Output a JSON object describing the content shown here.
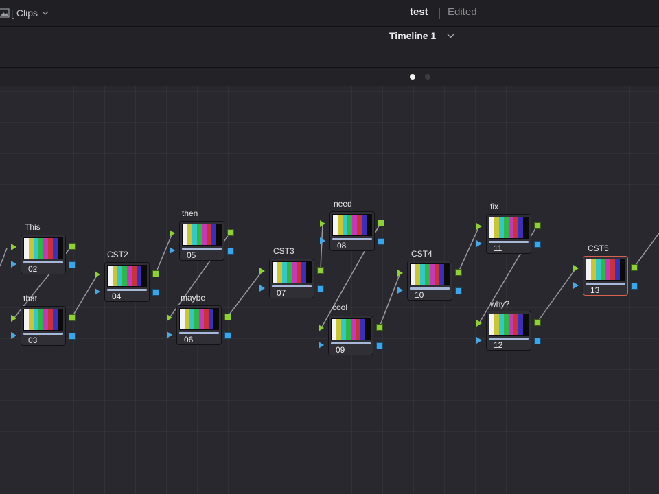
{
  "topbar": {
    "clips_label": "Clips",
    "bracket": "[",
    "project_name": "test",
    "project_status": "Edited"
  },
  "timeline": {
    "name": "Timeline 1"
  },
  "pager": {
    "pages": 2,
    "active_page": 1
  },
  "colors": {
    "rgb_port": "#8fcf3a",
    "key_port": "#4aa7e4",
    "selected_border": "#d8624f",
    "connection": "#9a9aa2"
  },
  "color_bars": [
    "#f4f4f4",
    "#c9c43a",
    "#35c7c0",
    "#2fb64f",
    "#c43ab2",
    "#c7323f",
    "#3c2fb4",
    "#0a0a0a"
  ],
  "nodes": [
    {
      "id": "02",
      "number": "02",
      "label": "This"
    },
    {
      "id": "03",
      "number": "03",
      "label": "that"
    },
    {
      "id": "04",
      "number": "04",
      "label": "CST2"
    },
    {
      "id": "05",
      "number": "05",
      "label": "then"
    },
    {
      "id": "06",
      "number": "06",
      "label": "maybe"
    },
    {
      "id": "07",
      "number": "07",
      "label": "CST3"
    },
    {
      "id": "08",
      "number": "08",
      "label": "need"
    },
    {
      "id": "09",
      "number": "09",
      "label": "cool"
    },
    {
      "id": "10",
      "number": "10",
      "label": "CST4"
    },
    {
      "id": "11",
      "number": "11",
      "label": "fix"
    },
    {
      "id": "12",
      "number": "12",
      "label": "why?"
    },
    {
      "id": "13",
      "number": "13",
      "label": "CST5",
      "selected": true
    }
  ]
}
